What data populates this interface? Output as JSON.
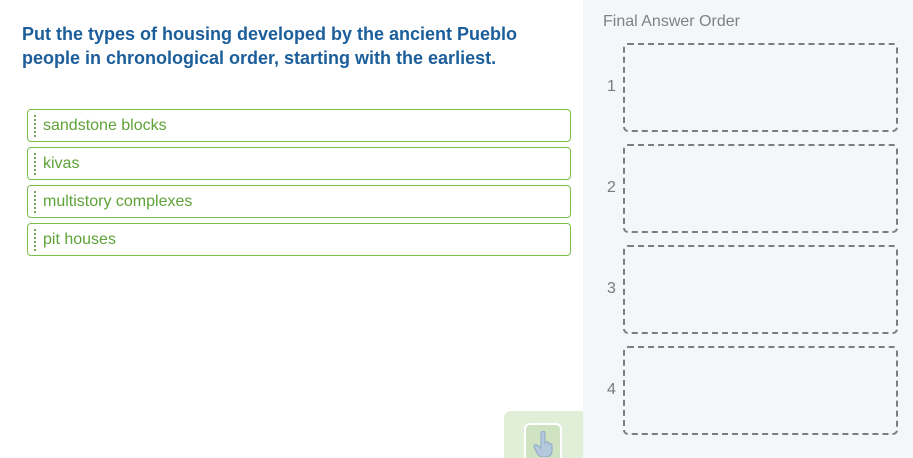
{
  "question": {
    "text": "Put the types of housing developed by the ancient Pueblo people in chronological order, starting with the earliest."
  },
  "options": [
    {
      "label": "sandstone blocks"
    },
    {
      "label": "kivas"
    },
    {
      "label": "multistory complexes"
    },
    {
      "label": "pit houses"
    }
  ],
  "answer_panel": {
    "title": "Final Answer Order",
    "slots": [
      {
        "number": "1"
      },
      {
        "number": "2"
      },
      {
        "number": "3"
      },
      {
        "number": "4"
      }
    ]
  },
  "colors": {
    "question_text": "#1b5e9a",
    "option_border": "#7bbf4a",
    "option_text": "#5ea238",
    "answer_panel_bg": "#f3f7fa",
    "hint_tab_bg": "#e1efd8"
  },
  "icons": {
    "drag_handle": "grip-dots-icon",
    "hint": "pointing-hand-icon"
  }
}
